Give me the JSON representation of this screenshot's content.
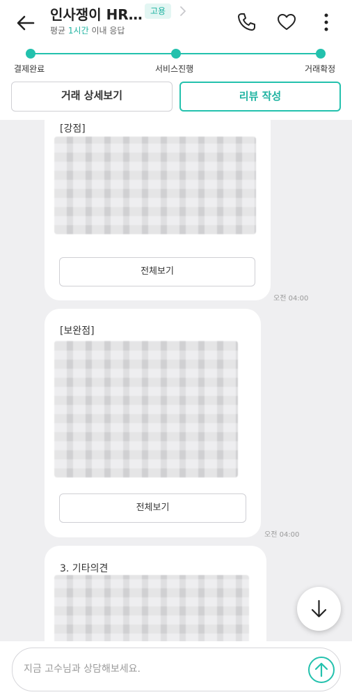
{
  "header": {
    "title": "인사쟁이 HR…",
    "badge": "고용",
    "subtitle_prefix": "평균",
    "subtitle_highlight": "1시간",
    "subtitle_suffix": "이내 응답",
    "accent": "#23c1ad",
    "icons": [
      "back-arrow-icon",
      "chevron-right-icon",
      "phone-icon",
      "heart-icon",
      "more-vertical-icon"
    ]
  },
  "progress": {
    "steps": [
      "결제완료",
      "서비스진행",
      "거래확정"
    ],
    "completed_steps": 3
  },
  "actions": {
    "detail_label": "거래 상세보기",
    "review_label": "리뷰 작성"
  },
  "chat": {
    "messages": [
      {
        "heading": "[강점]",
        "button": "전체보기",
        "time": "오전 04:00"
      },
      {
        "heading": "[보완점]",
        "button": "전체보기",
        "time": "오전 04:00"
      },
      {
        "heading": "3. 기타의견"
      }
    ]
  },
  "input": {
    "placeholder": "지금 고수님과 상담해보세요.",
    "value": ""
  }
}
